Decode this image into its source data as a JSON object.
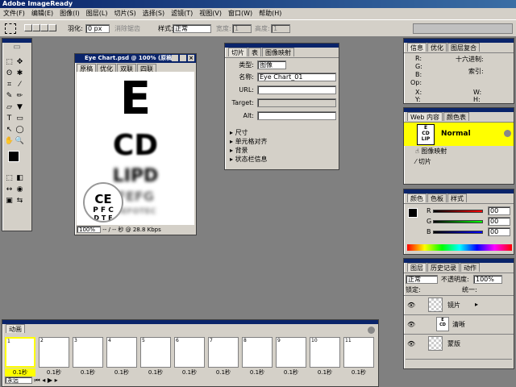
{
  "app": {
    "title": "Adobe ImageReady"
  },
  "menu": [
    "文件(F)",
    "编辑(E)",
    "图像(I)",
    "图层(L)",
    "切片(S)",
    "选择(S)",
    "滤镜(T)",
    "视图(V)",
    "窗口(W)",
    "帮助(H)"
  ],
  "options": {
    "feather_label": "羽化:",
    "feather_value": "0 px",
    "antialias_label": "消除锯齿",
    "style_label": "样式:",
    "style_value": "正常",
    "width_label": "宽度:",
    "width_value": "1",
    "height_label": "高度:",
    "height_value": "1"
  },
  "document": {
    "title": "Eye Chart.psd @ 100% (原稿)",
    "tabs": [
      "原稿",
      "优化",
      "双联",
      "四联"
    ],
    "zoom": "100%",
    "status": "-- / -- 秒 @ 28.8 Kbps",
    "lines": [
      "E",
      "CD",
      "LIPD",
      "FEFG",
      "DEFOTEC"
    ],
    "lens_lines": [
      "CE",
      "P F C",
      "D T E"
    ]
  },
  "slice_panel": {
    "tabs": [
      "切片",
      "表",
      "图像映射"
    ],
    "type_label": "类型:",
    "type_value": "图像",
    "name_label": "名称:",
    "name_value": "Eye Chart_01",
    "url_label": "URL:",
    "target_label": "Target:",
    "alt_label": "Alt:",
    "sections": [
      "尺寸",
      "单元格对齐",
      "背景",
      "状态栏信息"
    ]
  },
  "info_panel": {
    "tabs": [
      "信息",
      "优化",
      "图层复合"
    ],
    "rows": [
      [
        "R:",
        "十六进制:"
      ],
      [
        "G:",
        ""
      ],
      [
        "B:",
        "索引:"
      ],
      [
        "Op:",
        ""
      ]
    ],
    "xy": [
      "X:",
      "Y:",
      "W:",
      "H:"
    ]
  },
  "web_panel": {
    "tabs": [
      "Web 内容",
      "颜色表"
    ],
    "state": "Normal",
    "items": [
      "图像映射",
      "切片"
    ]
  },
  "color_panel": {
    "tabs": [
      "颜色",
      "色板",
      "样式"
    ],
    "channels": [
      "R",
      "G",
      "B"
    ],
    "values": [
      "00",
      "00",
      "00"
    ]
  },
  "layers_panel": {
    "tabs": [
      "图层",
      "历史记录",
      "动作"
    ],
    "blend": "正常",
    "opacity_label": "不透明度:",
    "opacity": "100%",
    "lock_label": "锁定:",
    "unify_label": "统一:",
    "layers": [
      "镜片",
      "清晰",
      "蒙版"
    ]
  },
  "animation": {
    "title": "动画",
    "frames": [
      "1",
      "2",
      "3",
      "4",
      "5",
      "6",
      "7",
      "8",
      "9",
      "10",
      "11"
    ],
    "delay": "0.1秒",
    "loop": "永远"
  },
  "colors": {
    "accent": "#ffff00",
    "title_bg": "#0a246a",
    "panel": "#d4d0c8",
    "desktop": "#808080"
  }
}
